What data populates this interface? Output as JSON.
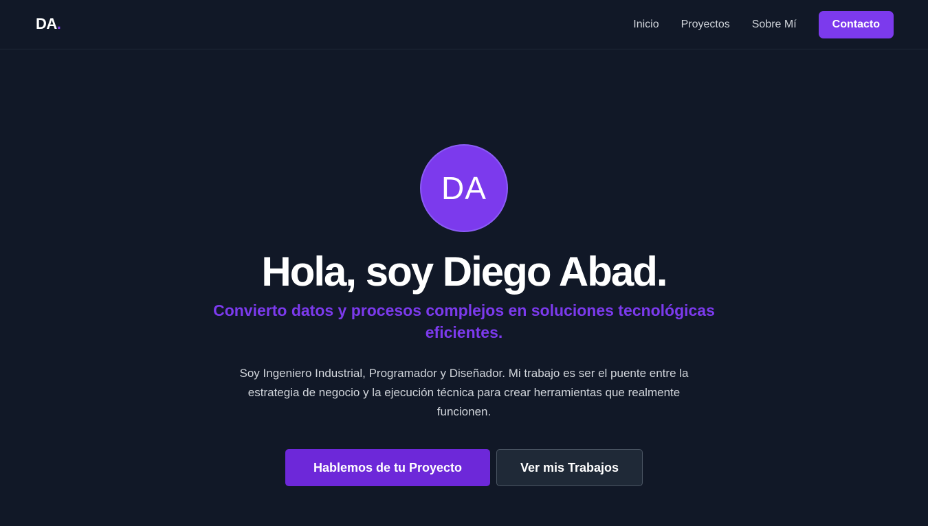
{
  "nav": {
    "logo_text": "DA",
    "logo_dot": ".",
    "links": [
      {
        "label": "Inicio"
      },
      {
        "label": "Proyectos"
      },
      {
        "label": "Sobre Mí"
      }
    ],
    "cta_label": "Contacto"
  },
  "hero": {
    "avatar_initials": "DA",
    "title": "Hola, soy Diego Abad.",
    "subtitle": "Convierto datos y procesos complejos en soluciones tecnológicas eficientes.",
    "description": "Soy Ingeniero Industrial, Programador y Diseñador. Mi trabajo es ser el puente entre la estrategia de negocio y la ejecución técnica para crear herramientas que realmente funcionen.",
    "primary_button": "Hablemos de tu Proyecto",
    "secondary_button": "Ver mis Trabajos"
  },
  "colors": {
    "background": "#111827",
    "accent": "#7c3aed",
    "text_muted": "#d1d5db"
  }
}
